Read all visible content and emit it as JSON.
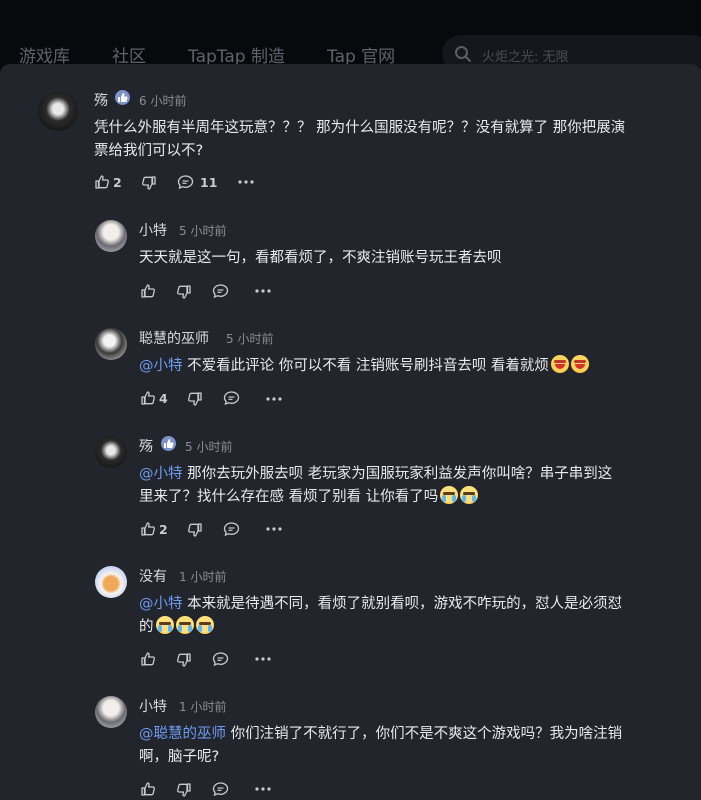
{
  "nav": {
    "items": [
      "游戏库",
      "社区",
      "TapTap 制造",
      "Tap 官网"
    ],
    "search_placeholder": "火炬之光: 无限"
  },
  "comment": {
    "author": "殇",
    "time": "6 小时前",
    "text_line1": "凭什么外服有半周年这玩意？？？ 那为什么国服没有呢？？没有就算了 那你把展演",
    "text_line2": "票给我们可以不?",
    "likes": "2",
    "replies": "11"
  },
  "replies": [
    {
      "author": "小特",
      "time": "5 小时前",
      "mention": "",
      "text_line1": "天天就是这一句，看都看烦了，不爽注销账号玩王者去呗",
      "text_line2": "",
      "likes": "",
      "emojis": []
    },
    {
      "author": "聪慧的巫师",
      "time": "5 小时前",
      "mention": "@小特",
      "text_line1": " 不爱看此评论 你可以不看 注销账号刷抖音去呗 看着就烦",
      "text_line2": "",
      "likes": "4",
      "emojis": [
        "hot-face",
        "hot-face"
      ]
    },
    {
      "author": "殇",
      "time": "5 小时前",
      "mention": "@小特",
      "text_line1": " 那你去玩外服去呗 老玩家为国服玩家利益发声你叫啥？串子串到这",
      "text_line2": "里来了？找什么存在感 看烦了别看 让你看了吗",
      "likes": "2",
      "emojis": [
        "crying-face",
        "crying-face"
      ]
    },
    {
      "author": "没有",
      "time": "1 小时前",
      "mention": "@小特",
      "text_line1": " 本来就是待遇不同，看烦了就别看呗，游戏不咋玩的，怼人是必须怼",
      "text_line2": "的",
      "likes": "",
      "emojis": [
        "crying-face",
        "crying-face",
        "crying-face"
      ]
    },
    {
      "author": "小特",
      "time": "1 小时前",
      "mention": "@聪慧的巫师",
      "text_line1": " 你们注销了不就行了，你们不是不爽这个游戏吗？我为啥注销",
      "text_line2": "啊，脑子呢?",
      "likes": "",
      "emojis": []
    }
  ],
  "colors": {
    "panel": "#23252d",
    "mention": "#6d9cf0",
    "badge": "#7e93c9"
  }
}
